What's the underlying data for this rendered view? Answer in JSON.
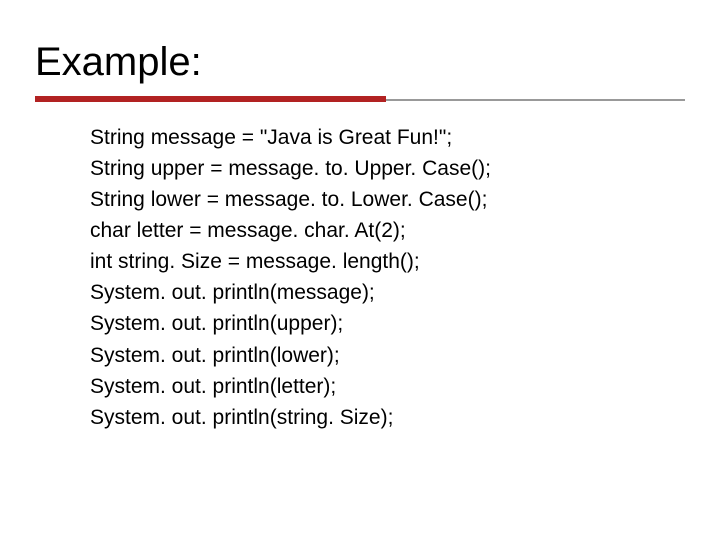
{
  "heading": "Example:",
  "code": {
    "line1": "String message = \"Java is Great Fun!\";",
    "line2": "String upper = message. to. Upper. Case();",
    "line3": "String lower = message. to. Lower. Case();",
    "line4": "char letter = message. char. At(2);",
    "line5": "int string. Size = message. length();",
    "line6": "System. out. println(message);",
    "line7": "System. out. println(upper);",
    "line8": "System. out. println(lower);",
    "line9": "System. out. println(letter);",
    "line10": "System. out. println(string. Size);"
  }
}
